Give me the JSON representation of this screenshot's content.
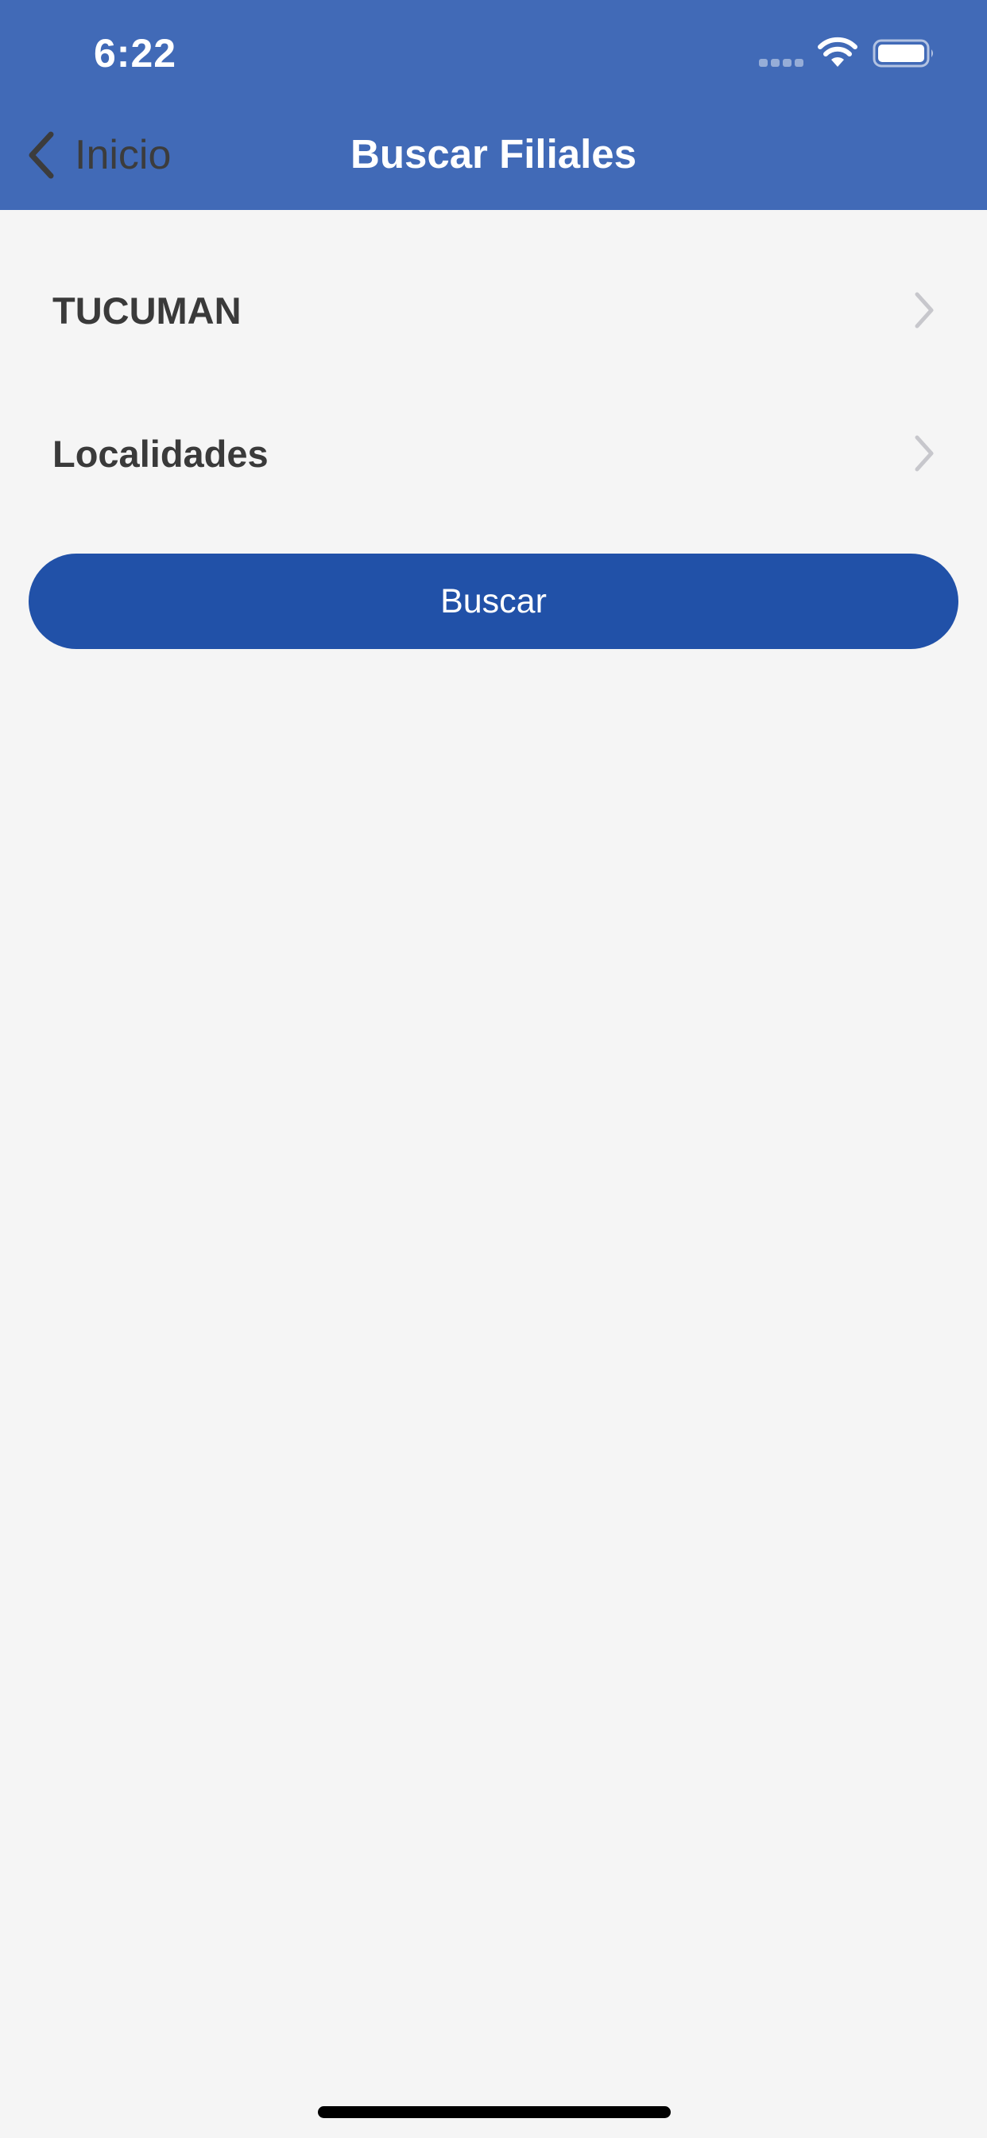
{
  "status_bar": {
    "time": "6:22"
  },
  "nav": {
    "back_label": "Inicio",
    "title": "Buscar Filiales"
  },
  "filters": [
    {
      "label": "TUCUMAN"
    },
    {
      "label": "Localidades"
    }
  ],
  "actions": {
    "search_label": "Buscar"
  },
  "colors": {
    "header_background": "#416ab7",
    "button_background": "#2151a8",
    "page_background": "#f5f5f5",
    "text_dark": "#3a3a3a",
    "chevron": "#c7c7cc"
  },
  "icons": {
    "back": "chevron-left-icon",
    "row_disclosure": "chevron-right-icon",
    "wifi": "wifi-icon",
    "battery": "battery-icon",
    "signal": "cellular-signal-icon"
  }
}
